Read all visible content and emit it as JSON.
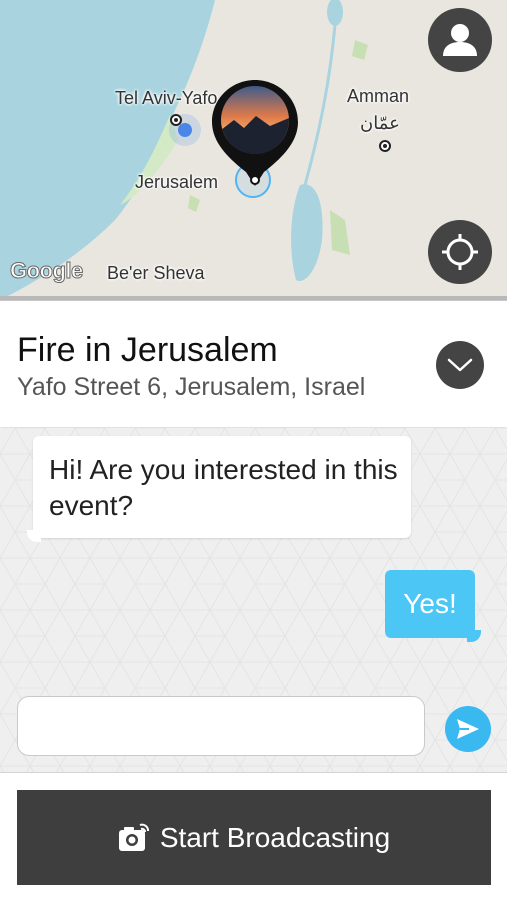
{
  "map": {
    "labels": {
      "tel_aviv": "Tel Aviv-Yafo",
      "amman_en": "Amman",
      "amman_ar": "عمّان",
      "jerusalem": "Jerusalem",
      "beer_sheva": "Be'er Sheva"
    },
    "google_logo": "Google",
    "icons": {
      "profile": "person-icon",
      "locate": "crosshair-icon",
      "pin": "event-pin-icon"
    }
  },
  "event": {
    "title": "Fire in Jerusalem",
    "address": "Yafo Street 6, Jerusalem, Israel",
    "expand_icon": "chevron-down-icon"
  },
  "chat": {
    "messages": [
      {
        "from": "bot",
        "text": "Hi! Are you interested in this event?"
      },
      {
        "from": "user",
        "text": "Yes!"
      }
    ],
    "input_value": "",
    "input_placeholder": "",
    "send_icon": "send-icon"
  },
  "footer": {
    "broadcast_label": "Start Broadcasting",
    "broadcast_icon": "camera-icon"
  },
  "colors": {
    "accent": "#3ab8f0",
    "user_bubble": "#4cc7f5",
    "dark_button": "#3e3e3e",
    "water": "#a9d4df",
    "land": "#e9e6df"
  }
}
